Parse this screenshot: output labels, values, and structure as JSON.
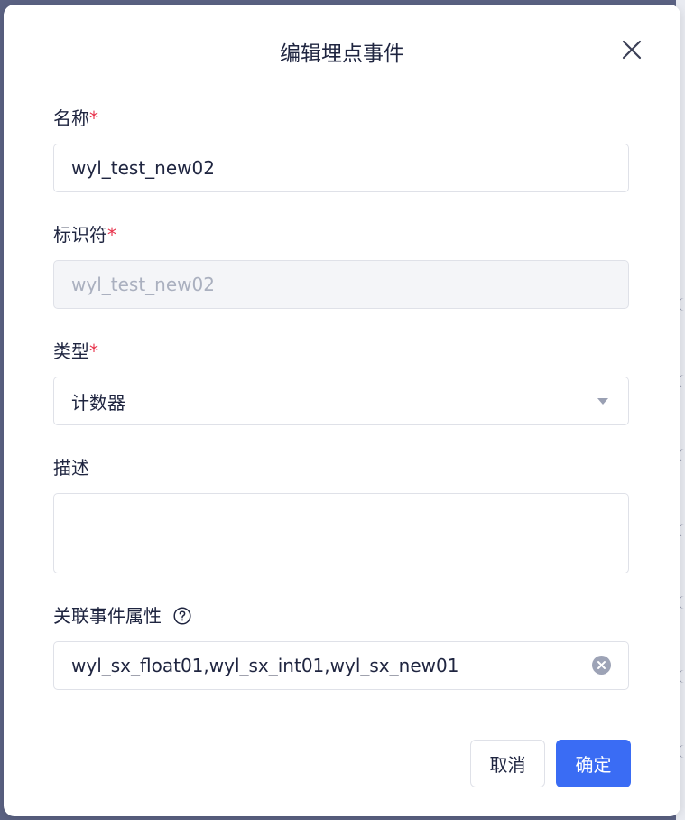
{
  "dialog": {
    "title": "编辑埋点事件",
    "close_icon": "close-icon"
  },
  "form": {
    "name": {
      "label": "名称",
      "required_mark": "*",
      "value": "wyl_test_new02"
    },
    "identifier": {
      "label": "标识符",
      "required_mark": "*",
      "value": "wyl_test_new02",
      "disabled": true
    },
    "type": {
      "label": "类型",
      "required_mark": "*",
      "selected": "计数器",
      "icon": "chevron-down-icon"
    },
    "description": {
      "label": "描述",
      "value": ""
    },
    "related_attrs": {
      "label": "关联事件属性",
      "help_icon": "question-circle-icon",
      "value": "wyl_sx_float01,wyl_sx_int01,wyl_sx_new01",
      "clear_icon": "clear-icon"
    }
  },
  "footer": {
    "cancel_label": "取消",
    "ok_label": "确定"
  },
  "colors": {
    "primary": "#3a6cf4",
    "required": "#e8324b",
    "overlay": "#5b6283"
  }
}
